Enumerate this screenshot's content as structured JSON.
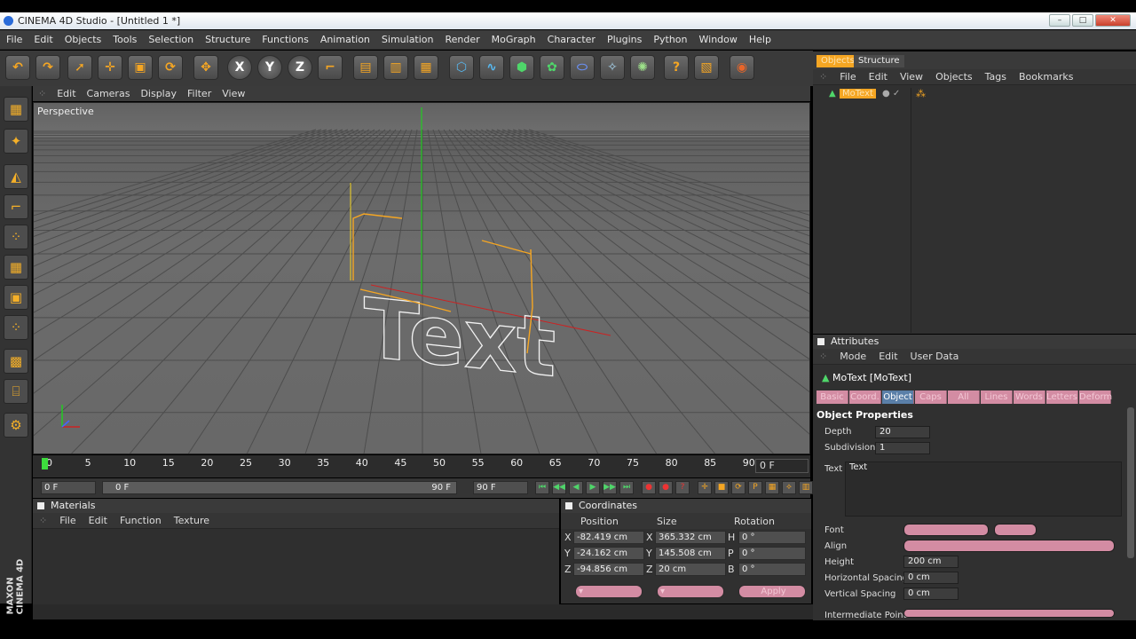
{
  "window": {
    "title": "CINEMA 4D Studio - [Untitled 1 *]"
  },
  "menubar": [
    "File",
    "Edit",
    "Objects",
    "Tools",
    "Selection",
    "Structure",
    "Functions",
    "Animation",
    "Simulation",
    "Render",
    "MoGraph",
    "Character",
    "Plugins",
    "Python",
    "Window",
    "Help"
  ],
  "toolbar": {
    "icons": [
      "undo-icon",
      "redo-icon",
      "live-selection-icon",
      "move-icon",
      "scale-icon",
      "rotate-icon",
      "move-tool-icon",
      "x-axis-lock-icon",
      "y-axis-lock-icon",
      "z-axis-lock-icon",
      "coordinate-system-icon",
      "render-view-icon",
      "render-picture-viewer-icon",
      "render-settings-icon",
      "cube-primitive-icon",
      "spline-icon",
      "nurbs-icon",
      "array-icon",
      "deformer-icon",
      "environment-icon",
      "particle-icon",
      "camera-icon",
      "scene-icon",
      "light-icon"
    ],
    "axis_x": "X",
    "axis_y": "Y",
    "axis_z": "Z"
  },
  "left_tools": [
    "layout-icon",
    "make-editable-icon",
    "model-mode-icon",
    "object-axis-icon",
    "points-mode-icon",
    "edges-mode-icon",
    "polygons-mode-icon",
    "enable-axis-icon",
    "texture-icon",
    "workplane-icon",
    "snapping-icon"
  ],
  "viewport": {
    "menu": [
      "Edit",
      "Cameras",
      "Display",
      "Filter",
      "View"
    ],
    "label": "Perspective",
    "scene_text": "Text"
  },
  "timeline": {
    "ticks": [
      "0",
      "5",
      "10",
      "15",
      "20",
      "25",
      "30",
      "35",
      "40",
      "45",
      "50",
      "55",
      "60",
      "65",
      "70",
      "75",
      "80",
      "85",
      "90"
    ],
    "current_frame": "0 F"
  },
  "transport": {
    "start": "0 F",
    "range_start": "0 F",
    "range_end": "90 F",
    "end": "90 F"
  },
  "materials": {
    "title": "Materials",
    "menu": [
      "File",
      "Edit",
      "Function",
      "Texture"
    ]
  },
  "coordinates": {
    "title": "Coordinates",
    "col_position": "Position",
    "col_size": "Size",
    "col_rotation": "Rotation",
    "rows": [
      {
        "axis": "X",
        "pos": "-82.419 cm",
        "size_axis": "X",
        "size": "365.332 cm",
        "rot_axis": "H",
        "rot": "0 °"
      },
      {
        "axis": "Y",
        "pos": "-24.162 cm",
        "size_axis": "Y",
        "size": "145.508 cm",
        "rot_axis": "P",
        "rot": "0 °"
      },
      {
        "axis": "Z",
        "pos": "-94.856 cm",
        "size_axis": "Z",
        "size": "20 cm",
        "rot_axis": "B",
        "rot": "0 °"
      }
    ],
    "apply": "Apply"
  },
  "objects_panel": {
    "tabs": [
      "Objects",
      "Structure"
    ],
    "menu": [
      "File",
      "Edit",
      "View",
      "Objects",
      "Tags",
      "Bookmarks"
    ],
    "items": [
      {
        "name": "MoText"
      }
    ]
  },
  "attributes": {
    "title": "Attributes",
    "menu": [
      "Mode",
      "Edit",
      "User Data"
    ],
    "object_name": "MoText [MoText]",
    "tabs": [
      "Basic",
      "Coord.",
      "Object",
      "Caps",
      "All",
      "Lines",
      "Words",
      "Letters",
      "Deform"
    ],
    "active_tab": "Object",
    "section": "Object Properties",
    "depth_label": "Depth",
    "depth": "20",
    "subdivision_label": "Subdivision",
    "subdivision": "1",
    "text_label": "Text",
    "text_value": "Text",
    "font_label": "Font",
    "align_label": "Align",
    "height_label": "Height",
    "height": "200 cm",
    "hspacing_label": "Horizontal Spacing",
    "hspacing": "0 cm",
    "vspacing_label": "Vertical Spacing",
    "vspacing": "0 cm",
    "ipoints_label": "Intermediate Points"
  },
  "branding": {
    "line1": "MAXON",
    "line2": "CINEMA 4D"
  },
  "colors": {
    "accent_orange": "#f5a623",
    "highlight_pink": "#d38ca3",
    "active_tab_blue": "#5a7fa8"
  }
}
